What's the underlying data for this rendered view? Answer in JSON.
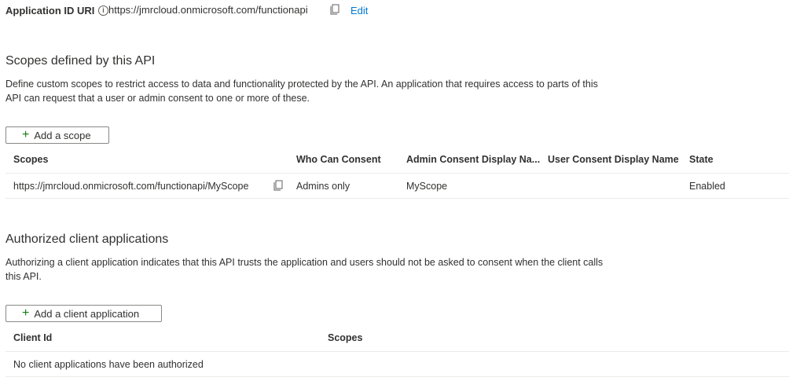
{
  "app_id": {
    "label": "Application ID URI",
    "info_icon": "info-icon",
    "value": "https://jmrcloud.onmicrosoft.com/functionapi",
    "copy_icon": "copy-icon",
    "edit_label": "Edit"
  },
  "scopes_section": {
    "title": "Scopes defined by this API",
    "description_line1": "Define custom scopes to restrict access to data and functionality protected by the API. An application that requires access to parts of this",
    "description_line2": "API can request that a user or admin consent to one or more of these.",
    "add_button": "Add a scope",
    "columns": [
      "Scopes",
      "Who Can Consent",
      "Admin Consent Display Na...",
      "User Consent Display Name",
      "State"
    ],
    "rows": [
      {
        "scope": "https://jmrcloud.onmicrosoft.com/functionapi/MyScope",
        "who_can_consent": "Admins only",
        "admin_display_name": "MyScope",
        "user_display_name": "",
        "state": "Enabled"
      }
    ]
  },
  "clients_section": {
    "title": "Authorized client applications",
    "description_line1": "Authorizing a client application indicates that this API trusts the application and users should not be asked to consent when the client calls",
    "description_line2": "this API.",
    "add_button": "Add a client application",
    "columns": [
      "Client Id",
      "Scopes"
    ],
    "empty_message": "No client applications have been authorized"
  },
  "colors": {
    "link": "#0078d4",
    "plus": "#107c10",
    "border": "#8a8886",
    "divider": "#edebe9"
  }
}
